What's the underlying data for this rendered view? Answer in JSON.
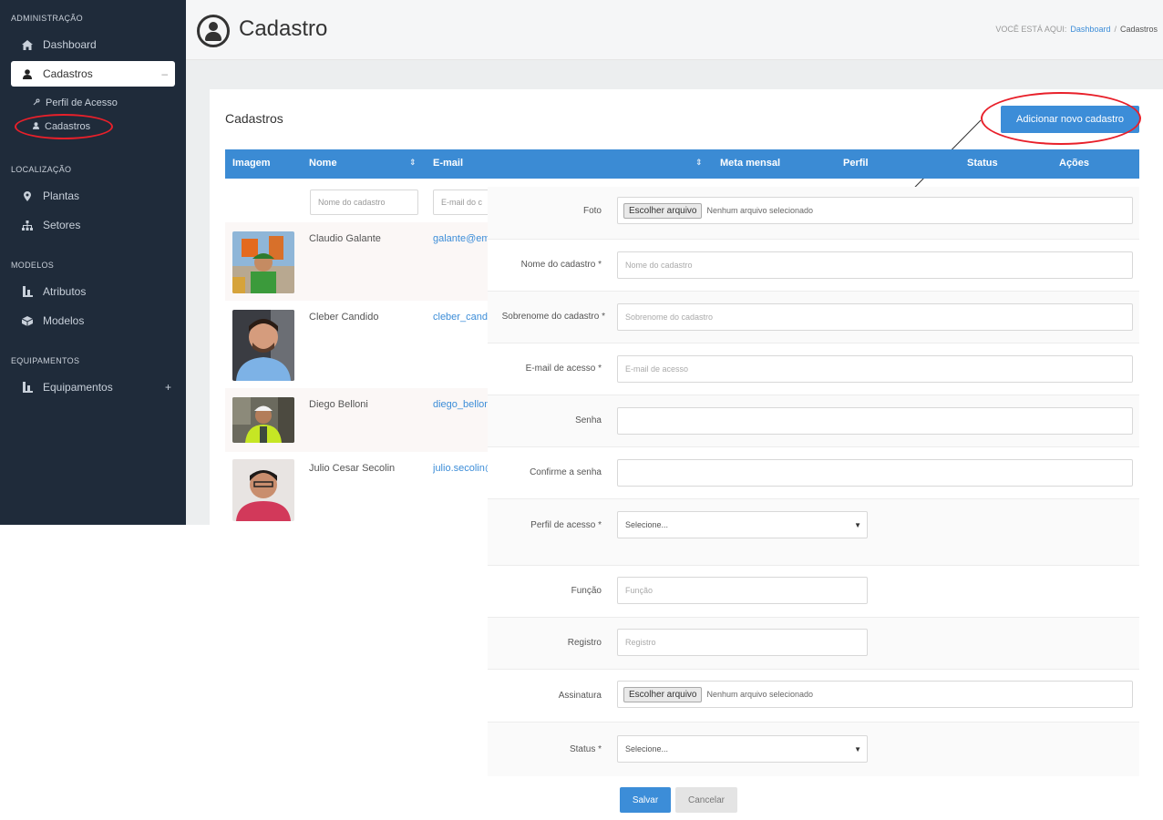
{
  "colors": {
    "sidebar_bg": "#1f2b3a",
    "primary": "#3c8dd8",
    "annotation_red": "#e8202a"
  },
  "sidebar": {
    "sections": [
      {
        "title": "ADMINISTRAÇÃO"
      },
      {
        "title": "LOCALIZAÇÃO"
      },
      {
        "title": "MODELOS"
      },
      {
        "title": "EQUIPAMENTOS"
      }
    ],
    "items": [
      {
        "label": "Dashboard",
        "icon": "home-icon"
      },
      {
        "label": "Cadastros",
        "icon": "user-icon",
        "toggle": "–"
      },
      {
        "label": "Plantas",
        "icon": "map-marker-icon"
      },
      {
        "label": "Setores",
        "icon": "sitemap-icon"
      },
      {
        "label": "Atributos",
        "icon": "attributes-icon"
      },
      {
        "label": "Modelos",
        "icon": "cube-icon"
      },
      {
        "label": "Equipamentos",
        "icon": "equipment-icon",
        "toggle": "+"
      }
    ],
    "subitems": [
      {
        "label": "Perfil de Acesso",
        "icon": "key-icon"
      },
      {
        "label": "Cadastros",
        "icon": "user-icon"
      }
    ]
  },
  "header": {
    "title": "Cadastro",
    "breadcrumb": {
      "prefix": "VOCÊ ESTÁ AQUI:",
      "link": "Dashboard",
      "separator": "/",
      "current": "Cadastros"
    }
  },
  "panel": {
    "title": "Cadastros",
    "add_button": "Adicionar novo cadastro"
  },
  "table": {
    "columns": [
      "Imagem",
      "Nome",
      "E-mail",
      "Meta mensal",
      "Perfil",
      "Status",
      "Ações"
    ],
    "filters": {
      "name_placeholder": "Nome do cadastro",
      "email_placeholder": "E-mail do c"
    },
    "rows": [
      {
        "name": "Claudio Galante",
        "email": "galante@empresa.com"
      },
      {
        "name": "Cleber Candido",
        "email": "cleber_candido@empresa.com"
      },
      {
        "name": "Diego Belloni",
        "email": "diego_belloni@empresa.com"
      },
      {
        "name": "Julio Cesar Secolin",
        "email": "julio.secolin@empresa.com"
      }
    ]
  },
  "form": {
    "foto": {
      "label": "Foto",
      "button": "Escolher arquivo",
      "status": "Nenhum arquivo selecionado"
    },
    "nome": {
      "label": "Nome do cadastro *",
      "placeholder": "Nome do cadastro"
    },
    "sobrenome": {
      "label": "Sobrenome do cadastro *",
      "placeholder": "Sobrenome do cadastro"
    },
    "email": {
      "label": "E-mail de acesso *",
      "placeholder": "E-mail de acesso"
    },
    "senha": {
      "label": "Senha"
    },
    "confirme": {
      "label": "Confirme a senha"
    },
    "perfil": {
      "label": "Perfil de acesso *",
      "value": "Selecione..."
    },
    "funcao": {
      "label": "Função",
      "placeholder": "Função"
    },
    "registro": {
      "label": "Registro",
      "placeholder": "Registro"
    },
    "assinatura": {
      "label": "Assinatura",
      "button": "Escolher arquivo",
      "status": "Nenhum arquivo selecionado"
    },
    "status": {
      "label": "Status *",
      "value": "Selecione..."
    },
    "save": "Salvar",
    "cancel": "Cancelar"
  }
}
